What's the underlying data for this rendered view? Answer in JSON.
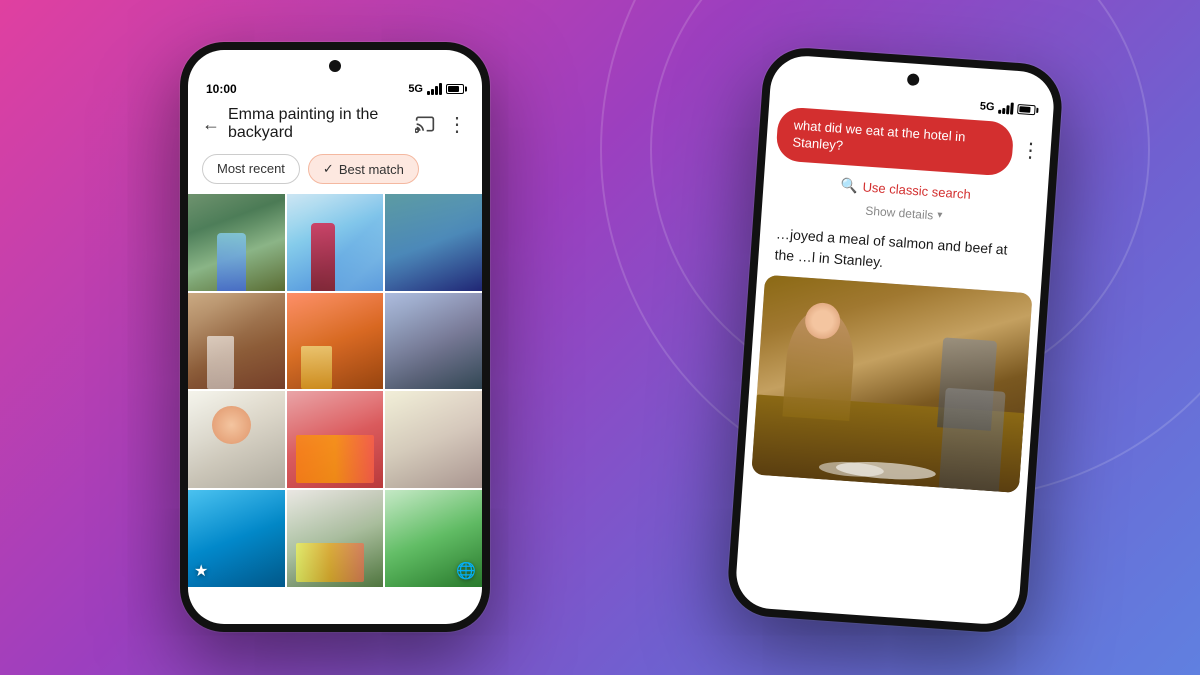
{
  "background": {
    "gradient_start": "#e040a0",
    "gradient_end": "#6080e0"
  },
  "phone_left": {
    "status_bar": {
      "time": "10:00",
      "network": "5G"
    },
    "header": {
      "title": "Emma painting in the backyard",
      "back_label": "←",
      "cast_icon": "cast",
      "more_icon": "more-vert"
    },
    "filters": {
      "option1": "Most recent",
      "option2": "Best match",
      "selected": "option2"
    },
    "grid_label": "Photo search results grid"
  },
  "phone_right": {
    "status_bar": {
      "network": "5G"
    },
    "search_query": "what did we eat at the hotel in Stanley?",
    "classic_search_label": "Use classic search",
    "show_details_label": "Show details",
    "result_text": "…joyed a meal of salmon and beef at the …l in Stanley.",
    "more_icon": "more-vert"
  }
}
